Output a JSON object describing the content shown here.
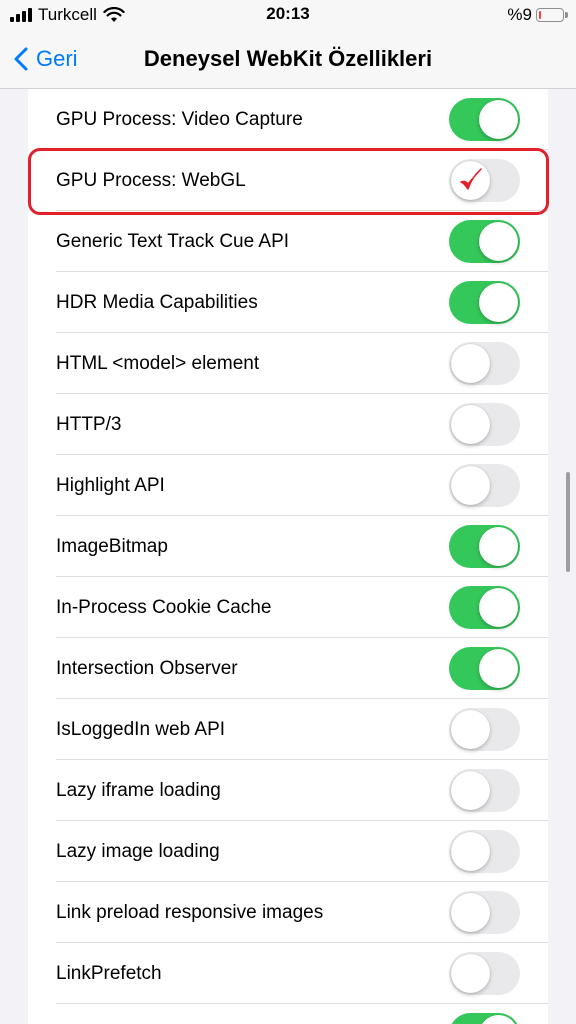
{
  "status_bar": {
    "carrier": "Turkcell",
    "time": "20:13",
    "battery_percent": "%9",
    "battery_level": 0.09,
    "battery_color": "#ff3b30"
  },
  "nav": {
    "back_label": "Geri",
    "title": "Deneysel WebKit Özellikleri"
  },
  "colors": {
    "toggle_on": "#34c759",
    "toggle_off": "#e9e9eb",
    "accent": "#007aff",
    "highlight": "#e0202b"
  },
  "items": [
    {
      "label": "GPU Process: Video Capture",
      "on": true
    },
    {
      "label": "GPU Process: WebGL",
      "on": false,
      "highlighted": true,
      "icon": "checkmark-icon"
    },
    {
      "label": "Generic Text Track Cue API",
      "on": true
    },
    {
      "label": "HDR Media Capabilities",
      "on": true
    },
    {
      "label": "HTML <model> element",
      "on": false
    },
    {
      "label": "HTTP/3",
      "on": false
    },
    {
      "label": "Highlight API",
      "on": false
    },
    {
      "label": "ImageBitmap",
      "on": true
    },
    {
      "label": "In-Process Cookie Cache",
      "on": true
    },
    {
      "label": "Intersection Observer",
      "on": true
    },
    {
      "label": "IsLoggedIn web API",
      "on": false
    },
    {
      "label": "Lazy iframe loading",
      "on": false
    },
    {
      "label": "Lazy image loading",
      "on": false
    },
    {
      "label": "Link preload responsive images",
      "on": false
    },
    {
      "label": "LinkPrefetch",
      "on": false
    },
    {
      "label": "",
      "on": true
    }
  ]
}
